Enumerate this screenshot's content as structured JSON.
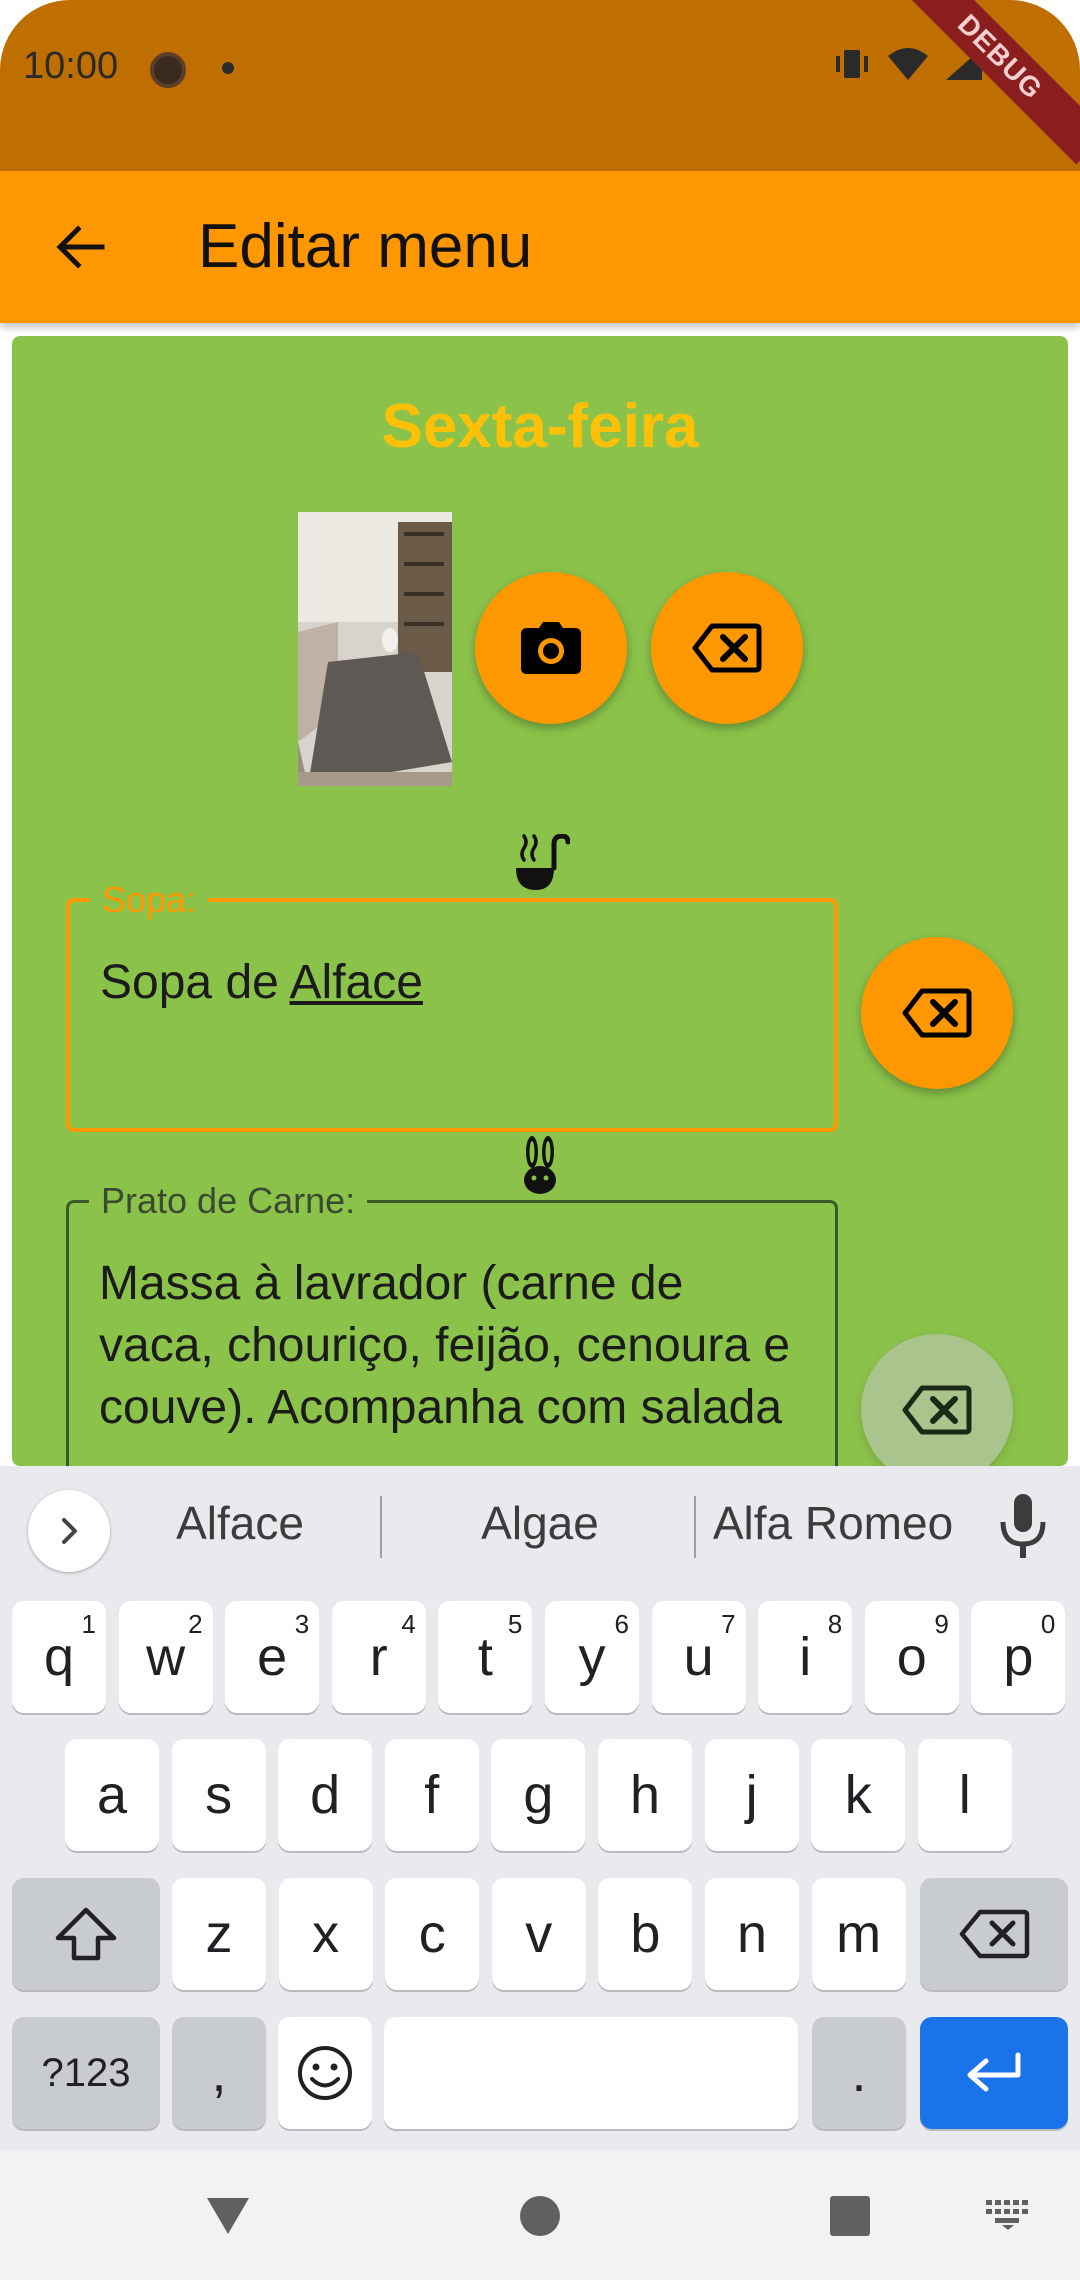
{
  "status_bar": {
    "time": "10:00",
    "debug_label": "DEBUG"
  },
  "app_bar": {
    "title": "Editar menu"
  },
  "card": {
    "day": "Sexta-feira",
    "fields": [
      {
        "label": "Sopa:",
        "value_plain": "Sopa de ",
        "value_underlined": "Alface",
        "icon": "soup-ladle-icon",
        "focused": true
      },
      {
        "label": "Prato de Carne:",
        "value": "Massa à lavrador (carne de vaca, chouriço, feijão, cenoura e couve). Acompanha com salada",
        "icon": "rabbit-icon",
        "focused": false
      }
    ]
  },
  "keyboard": {
    "suggestions": [
      "Alface",
      "Algae",
      "Alfa Romeo"
    ],
    "row1": [
      {
        "k": "q",
        "n": "1"
      },
      {
        "k": "w",
        "n": "2"
      },
      {
        "k": "e",
        "n": "3"
      },
      {
        "k": "r",
        "n": "4"
      },
      {
        "k": "t",
        "n": "5"
      },
      {
        "k": "y",
        "n": "6"
      },
      {
        "k": "u",
        "n": "7"
      },
      {
        "k": "i",
        "n": "8"
      },
      {
        "k": "o",
        "n": "9"
      },
      {
        "k": "p",
        "n": "0"
      }
    ],
    "row2": [
      "a",
      "s",
      "d",
      "f",
      "g",
      "h",
      "j",
      "k",
      "l"
    ],
    "row3": [
      "z",
      "x",
      "c",
      "v",
      "b",
      "n",
      "m"
    ],
    "symbols_label": "?123",
    "comma_label": ",",
    "period_label": "."
  },
  "colors": {
    "accent": "#ff9800",
    "card_background": "#8bc34a",
    "title_color": "#ffc107",
    "enter_key": "#1a73e8"
  }
}
